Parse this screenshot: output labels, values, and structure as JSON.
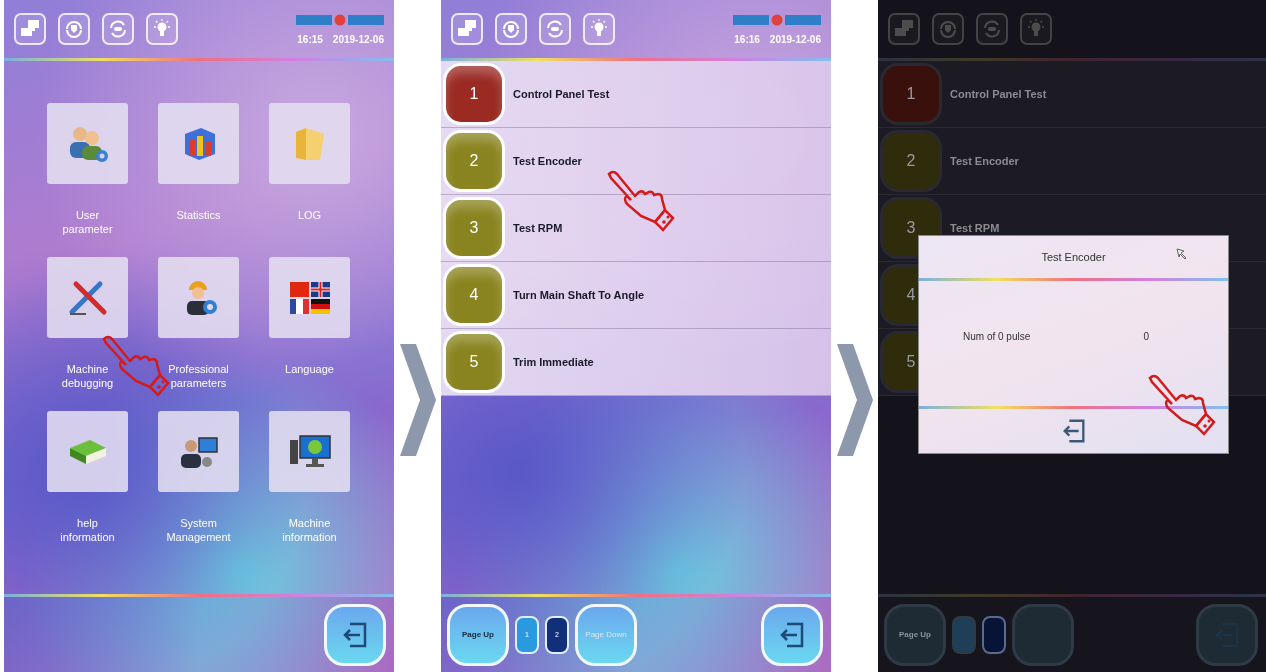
{
  "screens": [
    {
      "kind": "menu",
      "dimmed": false,
      "header": {
        "time": "16:15",
        "date": "2019-12-06"
      },
      "tiles": [
        {
          "label": "User parameter"
        },
        {
          "label": "Statistics"
        },
        {
          "label": "LOG"
        },
        {
          "label": "Machine debugging"
        },
        {
          "label": "Professional parameters"
        },
        {
          "label": "Language"
        },
        {
          "label": "help information"
        },
        {
          "label": "System Management"
        },
        {
          "label": "Machine information"
        }
      ]
    },
    {
      "kind": "list",
      "dimmed": false,
      "header": {
        "time": "16:16",
        "date": "2019-12-06"
      },
      "items": [
        {
          "number": "1",
          "label": "Control Panel Test",
          "color": "#9a2a22"
        },
        {
          "number": "2",
          "label": "Test Encoder",
          "color": "#8a8420"
        },
        {
          "number": "3",
          "label": "Test RPM",
          "color": "#8a8420"
        },
        {
          "number": "4",
          "label": "Turn Main Shaft To Angle",
          "color": "#8a8420"
        },
        {
          "number": "5",
          "label": "Trim Immediate",
          "color": "#8a8420"
        }
      ],
      "pager": {
        "page_up": "Page Up",
        "pages": [
          {
            "label": "1",
            "selected": false
          },
          {
            "label": "2",
            "selected": true
          }
        ],
        "page_down": "Page Down"
      }
    },
    {
      "kind": "list",
      "dimmed": true,
      "items": [
        {
          "number": "1",
          "label": "Control Panel Test",
          "color": "#3a100c"
        },
        {
          "number": "2",
          "label": "Test Encoder",
          "color": "#2e2c0a"
        },
        {
          "number": "3",
          "label": "Test RPM",
          "color": "#2e2c0a"
        },
        {
          "number": "4",
          "color": "#2e2c0a"
        },
        {
          "number": "5",
          "color": "#2e2c0a"
        }
      ],
      "pager": {
        "page_up": "Page Up",
        "pages": [
          {
            "selected": false
          },
          {
            "selected": true
          }
        ]
      },
      "dialog": {
        "title": "Test Encoder",
        "rows": [
          {
            "label": "Num of 0 pulse",
            "value": "0"
          }
        ]
      }
    }
  ]
}
